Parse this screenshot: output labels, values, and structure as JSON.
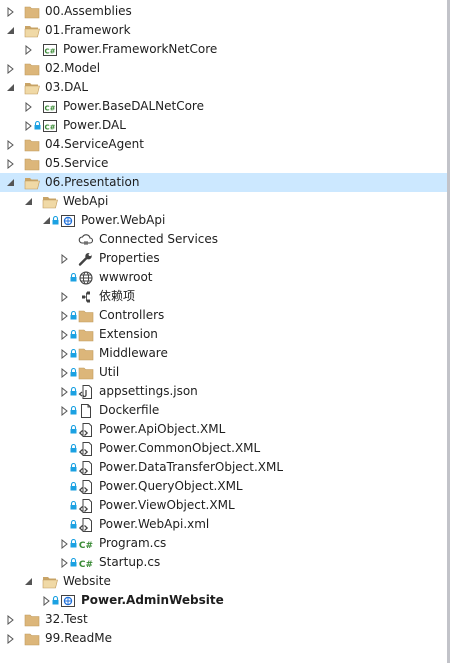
{
  "colors": {
    "folder": "#dcb67a",
    "selected": "#cce8ff",
    "csharp": "#388a34",
    "lock": "#1ba1e2",
    "webproject": "#1e6fd9"
  },
  "tree": [
    {
      "label": "00.Assemblies",
      "level": 0,
      "expand": "collapsed",
      "icon": "solution-folder-icon"
    },
    {
      "label": "01.Framework",
      "level": 0,
      "expand": "expanded",
      "icon": "solution-folder-open-icon"
    },
    {
      "label": "Power.FrameworkNetCore",
      "level": 1,
      "expand": "collapsed",
      "icon": "csharp-project-icon"
    },
    {
      "label": "02.Model",
      "level": 0,
      "expand": "collapsed",
      "icon": "solution-folder-icon"
    },
    {
      "label": "03.DAL",
      "level": 0,
      "expand": "expanded",
      "icon": "solution-folder-open-icon"
    },
    {
      "label": "Power.BaseDALNetCore",
      "level": 1,
      "expand": "collapsed",
      "icon": "csharp-project-icon"
    },
    {
      "label": "Power.DAL",
      "level": 1,
      "expand": "collapsed",
      "icon": "csharp-project-icon",
      "lock": true
    },
    {
      "label": "04.ServiceAgent",
      "level": 0,
      "expand": "collapsed",
      "icon": "solution-folder-icon"
    },
    {
      "label": "05.Service",
      "level": 0,
      "expand": "collapsed",
      "icon": "solution-folder-icon"
    },
    {
      "label": "06.Presentation",
      "level": 0,
      "expand": "expanded",
      "icon": "solution-folder-open-icon",
      "selected": true
    },
    {
      "label": "WebApi",
      "level": 1,
      "expand": "expanded",
      "icon": "solution-folder-open-icon"
    },
    {
      "label": "Power.WebApi",
      "level": 2,
      "expand": "expanded",
      "icon": "web-project-icon",
      "lock": true
    },
    {
      "label": "Connected Services",
      "level": 3,
      "expand": "none",
      "icon": "connected-services-icon"
    },
    {
      "label": "Properties",
      "level": 3,
      "expand": "collapsed",
      "icon": "wrench-icon"
    },
    {
      "label": "wwwroot",
      "level": 3,
      "expand": "none",
      "icon": "globe-icon",
      "lock": true
    },
    {
      "label": "依赖项",
      "level": 3,
      "expand": "collapsed",
      "icon": "dependencies-icon"
    },
    {
      "label": "Controllers",
      "level": 3,
      "expand": "collapsed",
      "icon": "folder-icon",
      "lock": true
    },
    {
      "label": "Extension",
      "level": 3,
      "expand": "collapsed",
      "icon": "folder-icon",
      "lock": true
    },
    {
      "label": "Middleware",
      "level": 3,
      "expand": "collapsed",
      "icon": "folder-icon",
      "lock": true
    },
    {
      "label": "Util",
      "level": 3,
      "expand": "collapsed",
      "icon": "folder-icon",
      "lock": true
    },
    {
      "label": "appsettings.json",
      "level": 3,
      "expand": "collapsed",
      "icon": "json-file-icon",
      "lock": true
    },
    {
      "label": "Dockerfile",
      "level": 3,
      "expand": "collapsed",
      "icon": "file-icon",
      "lock": true
    },
    {
      "label": "Power.ApiObject.XML",
      "level": 3,
      "expand": "none",
      "icon": "xml-file-icon",
      "lock": true
    },
    {
      "label": "Power.CommonObject.XML",
      "level": 3,
      "expand": "none",
      "icon": "xml-file-icon",
      "lock": true
    },
    {
      "label": "Power.DataTransferObject.XML",
      "level": 3,
      "expand": "none",
      "icon": "xml-file-icon",
      "lock": true
    },
    {
      "label": "Power.QueryObject.XML",
      "level": 3,
      "expand": "none",
      "icon": "xml-file-icon",
      "lock": true
    },
    {
      "label": "Power.ViewObject.XML",
      "level": 3,
      "expand": "none",
      "icon": "xml-file-icon",
      "lock": true
    },
    {
      "label": "Power.WebApi.xml",
      "level": 3,
      "expand": "none",
      "icon": "xml-file-icon",
      "lock": true
    },
    {
      "label": "Program.cs",
      "level": 3,
      "expand": "collapsed",
      "icon": "csharp-file-icon",
      "lock": true
    },
    {
      "label": "Startup.cs",
      "level": 3,
      "expand": "collapsed",
      "icon": "csharp-file-icon",
      "lock": true
    },
    {
      "label": "Website",
      "level": 1,
      "expand": "expanded",
      "icon": "solution-folder-open-icon"
    },
    {
      "label": "Power.AdminWebsite",
      "level": 2,
      "expand": "collapsed",
      "icon": "web-project-icon",
      "lock": true,
      "bold": true
    },
    {
      "label": "32.Test",
      "level": 0,
      "expand": "collapsed",
      "icon": "solution-folder-icon"
    },
    {
      "label": "99.ReadMe",
      "level": 0,
      "expand": "collapsed",
      "icon": "solution-folder-icon"
    }
  ]
}
